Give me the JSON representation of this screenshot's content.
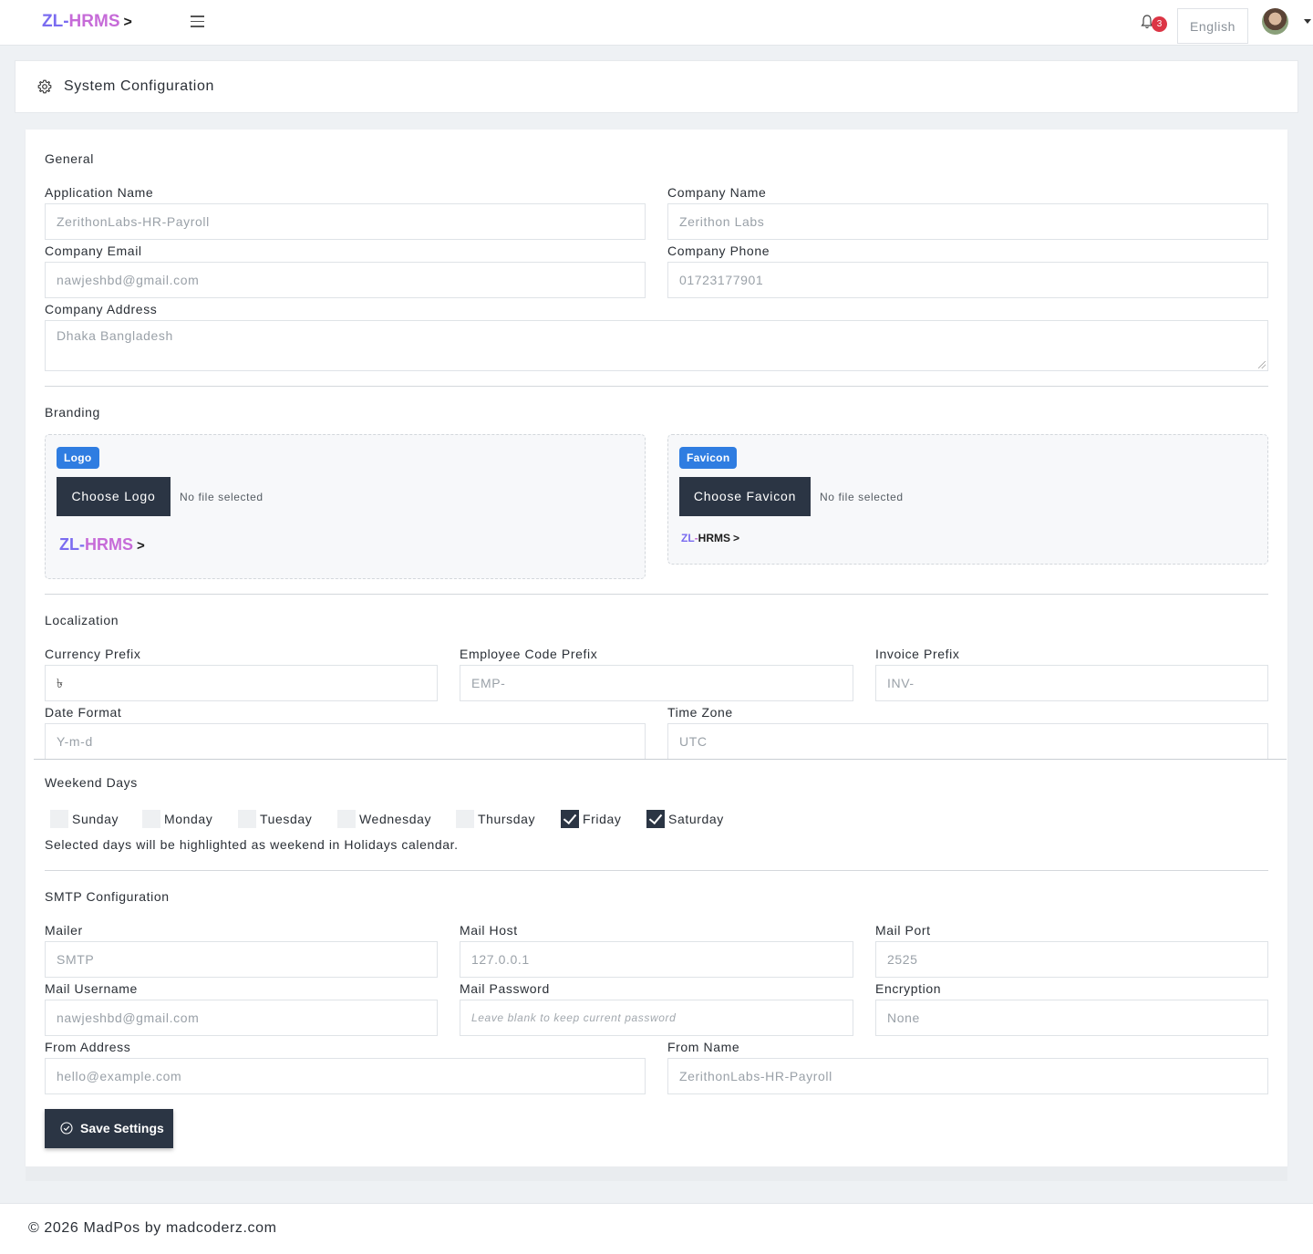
{
  "app": {
    "brand_zl": "ZL",
    "brand_dash": "-",
    "brand_hrms": "HRMS",
    "brand_gt": ">",
    "notification_count": "3",
    "language": "English"
  },
  "page": {
    "title": "System Configuration"
  },
  "general": {
    "title": "General",
    "application_name_label": "Application Name",
    "application_name": "ZerithonLabs-HR-Payroll",
    "company_name_label": "Company Name",
    "company_name": "Zerithon Labs",
    "company_email_label": "Company Email",
    "company_email": "nawjeshbd@gmail.com",
    "company_phone_label": "Company Phone",
    "company_phone": "01723177901",
    "company_address_label": "Company Address",
    "company_address": "Dhaka Bangladesh"
  },
  "branding": {
    "title": "Branding",
    "logo_tag": "Logo",
    "choose_logo": "Choose Logo",
    "logo_file": "No file selected",
    "favicon_tag": "Favicon",
    "choose_favicon": "Choose Favicon",
    "favicon_file": "No file selected"
  },
  "localization": {
    "title": "Localization",
    "currency_prefix_label": "Currency Prefix",
    "currency_prefix": "৳",
    "employee_code_prefix_label": "Employee Code Prefix",
    "employee_code_prefix": "EMP-",
    "invoice_prefix_label": "Invoice Prefix",
    "invoice_prefix": "INV-",
    "date_format_label": "Date Format",
    "date_format": "Y-m-d",
    "time_zone_label": "Time Zone",
    "time_zone": "UTC"
  },
  "weekend": {
    "title": "Weekend Days",
    "days": [
      {
        "label": "Sunday",
        "checked": false
      },
      {
        "label": "Monday",
        "checked": false
      },
      {
        "label": "Tuesday",
        "checked": false
      },
      {
        "label": "Wednesday",
        "checked": false
      },
      {
        "label": "Thursday",
        "checked": false
      },
      {
        "label": "Friday",
        "checked": true
      },
      {
        "label": "Saturday",
        "checked": true
      }
    ],
    "help": "Selected days will be highlighted as weekend in Holidays calendar."
  },
  "smtp": {
    "title": "SMTP Configuration",
    "mailer_label": "Mailer",
    "mailer": "SMTP",
    "mail_host_label": "Mail Host",
    "mail_host": "127.0.0.1",
    "mail_port_label": "Mail Port",
    "mail_port": "2525",
    "mail_username_label": "Mail Username",
    "mail_username": "nawjeshbd@gmail.com",
    "mail_password_label": "Mail Password",
    "mail_password_placeholder": "Leave blank to keep current password",
    "encryption_label": "Encryption",
    "encryption": "None",
    "from_address_label": "From Address",
    "from_address": "hello@example.com",
    "from_name_label": "From Name",
    "from_name": "ZerithonLabs-HR-Payroll"
  },
  "actions": {
    "save": "Save Settings"
  },
  "footer": {
    "text": "© 2026 MadPos by madcoderz.com"
  },
  "colors": {
    "accent": "#2f7de1",
    "dark_button": "#2b3544",
    "badge": "#dc3545",
    "brand_zl": "#7a6cf0",
    "brand_hrms": "#c66bd8"
  }
}
